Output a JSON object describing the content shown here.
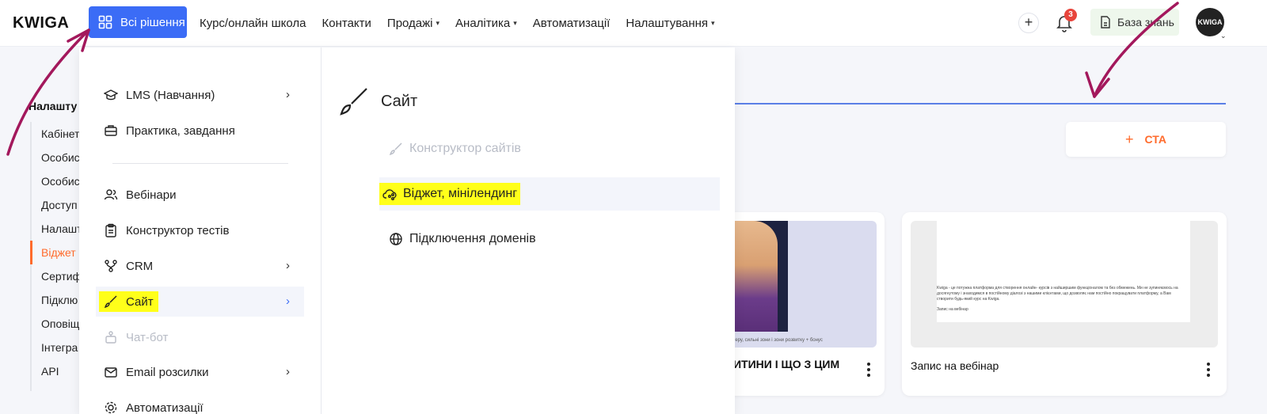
{
  "topbar": {
    "logo": "KWIGA",
    "all_solutions": "Всі рішення",
    "nav": [
      {
        "label": "Курс/онлайн школа",
        "caret": false
      },
      {
        "label": "Контакти",
        "caret": false
      },
      {
        "label": "Продажі",
        "caret": true
      },
      {
        "label": "Аналітика",
        "caret": true
      },
      {
        "label": "Автоматизації",
        "caret": false
      },
      {
        "label": "Налаштування",
        "caret": true
      }
    ],
    "notifications_count": "3",
    "knowledge_base": "База знань",
    "avatar_text": "KWIGA"
  },
  "settings": {
    "title": "Налашту",
    "items": [
      "Кабінет",
      "Особис",
      "Особис",
      "Доступ",
      "Налашт",
      "Віджет",
      "Сертиф",
      "Підклю",
      "Оповіщ",
      "Інтегра",
      "API"
    ],
    "active_index": 5
  },
  "main": {
    "cta_label": "СТА",
    "cards": [
      {
        "title": "ДИТИНИ І ЩО З ЦИМ",
        "caption": "характеру, сильні зони і зони розвитку + бонус"
      },
      {
        "title": "Запис на вебінар",
        "preview_text": "Kwiga - це потужна платформа для створення онлайн- курсів з найширшим функціоналом та без обмежень. Ми не зупиняємось на досягнутому і знаходимся в постійному діалозі з нашими клієнтами, що дозволяє нам постійно покращувати платформу, а Вам створити будь-який курс на Kwiga.",
        "preview_footer": "Запис на вебінар"
      }
    ]
  },
  "dropdown": {
    "left_items": [
      {
        "label": "LMS (Навчання)",
        "icon": "graduation-cap-icon",
        "arrow": true,
        "state": "normal"
      },
      {
        "label": "Практика, завдання",
        "icon": "briefcase-icon",
        "arrow": false,
        "state": "normal"
      },
      {
        "label": "Вебінари",
        "icon": "users-icon",
        "arrow": false,
        "state": "normal"
      },
      {
        "label": "Конструктор тестів",
        "icon": "clipboard-icon",
        "arrow": false,
        "state": "normal"
      },
      {
        "label": "CRM",
        "icon": "branch-icon",
        "arrow": true,
        "state": "normal"
      },
      {
        "label": "Сайт",
        "icon": "brush-icon",
        "arrow": true,
        "state": "active"
      },
      {
        "label": "Чат-бот",
        "icon": "bot-icon",
        "arrow": false,
        "state": "disabled"
      },
      {
        "label": "Email розсилки",
        "icon": "mail-icon",
        "arrow": true,
        "state": "normal"
      },
      {
        "label": "Автоматизації",
        "icon": "gear-icon",
        "arrow": false,
        "state": "normal"
      }
    ],
    "section_title": "Сайт",
    "sub_items": [
      {
        "label": "Конструктор сайтів",
        "icon": "brush-icon",
        "state": "disabled"
      },
      {
        "label": "Віджет, мінілендинг",
        "icon": "cloud-share-icon",
        "state": "active"
      },
      {
        "label": "Підключення доменів",
        "icon": "globe-icon",
        "state": "normal"
      }
    ]
  },
  "colors": {
    "primary": "#3b6cf6",
    "accent": "#ff6b2c",
    "highlight": "#ffff1a",
    "annotation": "#a3185c"
  }
}
